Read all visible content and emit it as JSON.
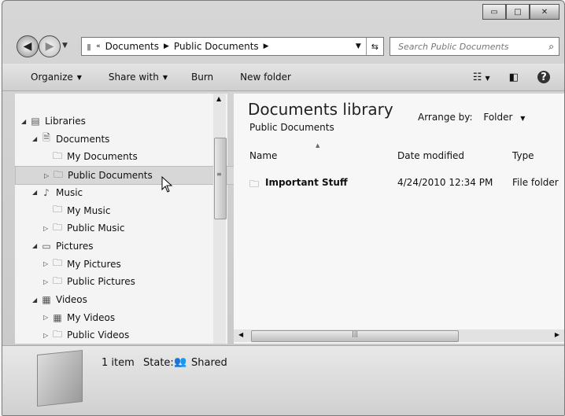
{
  "window": {
    "caption": {
      "minimize": "▭",
      "maximize": "□",
      "close": "✕"
    }
  },
  "nav": {
    "back_icon": "◀",
    "forward_icon": "▶",
    "dropdown": "▼"
  },
  "address": {
    "prefix": "«",
    "crumbs": [
      "Documents",
      "Public Documents"
    ],
    "sep": "▶",
    "drop": "▼",
    "refresh": "⇆"
  },
  "search": {
    "placeholder": "Search Public Documents",
    "icon": "⌕"
  },
  "toolbar": {
    "organize": "Organize",
    "share_with": "Share with",
    "burn": "Burn",
    "new_folder": "New folder",
    "arrow": "▼",
    "views_icon": "☷",
    "preview_icon": "◧",
    "help_icon": "?"
  },
  "tree": [
    {
      "label": "Libraries",
      "twisty": "◢",
      "icon": "▤",
      "indent": 0
    },
    {
      "label": "Documents",
      "twisty": "◢",
      "icon": "🗎",
      "indent": 1
    },
    {
      "label": "My Documents",
      "twisty": "",
      "icon": "🗀",
      "indent": 2
    },
    {
      "label": "Public Documents",
      "twisty": "▷",
      "icon": "🗀",
      "indent": 2,
      "selected": true
    },
    {
      "label": "Music",
      "twisty": "◢",
      "icon": "♪",
      "indent": 1
    },
    {
      "label": "My Music",
      "twisty": "",
      "icon": "🗀",
      "indent": 2
    },
    {
      "label": "Public Music",
      "twisty": "▷",
      "icon": "🗀",
      "indent": 2
    },
    {
      "label": "Pictures",
      "twisty": "◢",
      "icon": "▭",
      "indent": 1
    },
    {
      "label": "My Pictures",
      "twisty": "▷",
      "icon": "🗀",
      "indent": 2
    },
    {
      "label": "Public Pictures",
      "twisty": "▷",
      "icon": "🗀",
      "indent": 2
    },
    {
      "label": "Videos",
      "twisty": "◢",
      "icon": "▦",
      "indent": 1
    },
    {
      "label": "My Videos",
      "twisty": "▷",
      "icon": "▦",
      "indent": 2
    },
    {
      "label": "Public Videos",
      "twisty": "▷",
      "icon": "🗀",
      "indent": 2
    }
  ],
  "library": {
    "title": "Documents library",
    "subtitle": "Public Documents",
    "arrange_label": "Arrange by:",
    "arrange_value": "Folder",
    "arrange_arrow": "▼"
  },
  "columns": {
    "name": "Name",
    "date": "Date modified",
    "type": "Type",
    "sort_arrow": "▲"
  },
  "files": [
    {
      "icon": "🗀",
      "name": "Important Stuff",
      "date": "4/24/2010 12:34 PM",
      "type": "File folder"
    }
  ],
  "details": {
    "count": "1 item",
    "state_label": "State:",
    "state_icon": "👥",
    "state_value": "Shared"
  },
  "scroll": {
    "up": "▲",
    "left": "◀",
    "right": "▶",
    "grip": "≡",
    "hgrip": "|||"
  }
}
